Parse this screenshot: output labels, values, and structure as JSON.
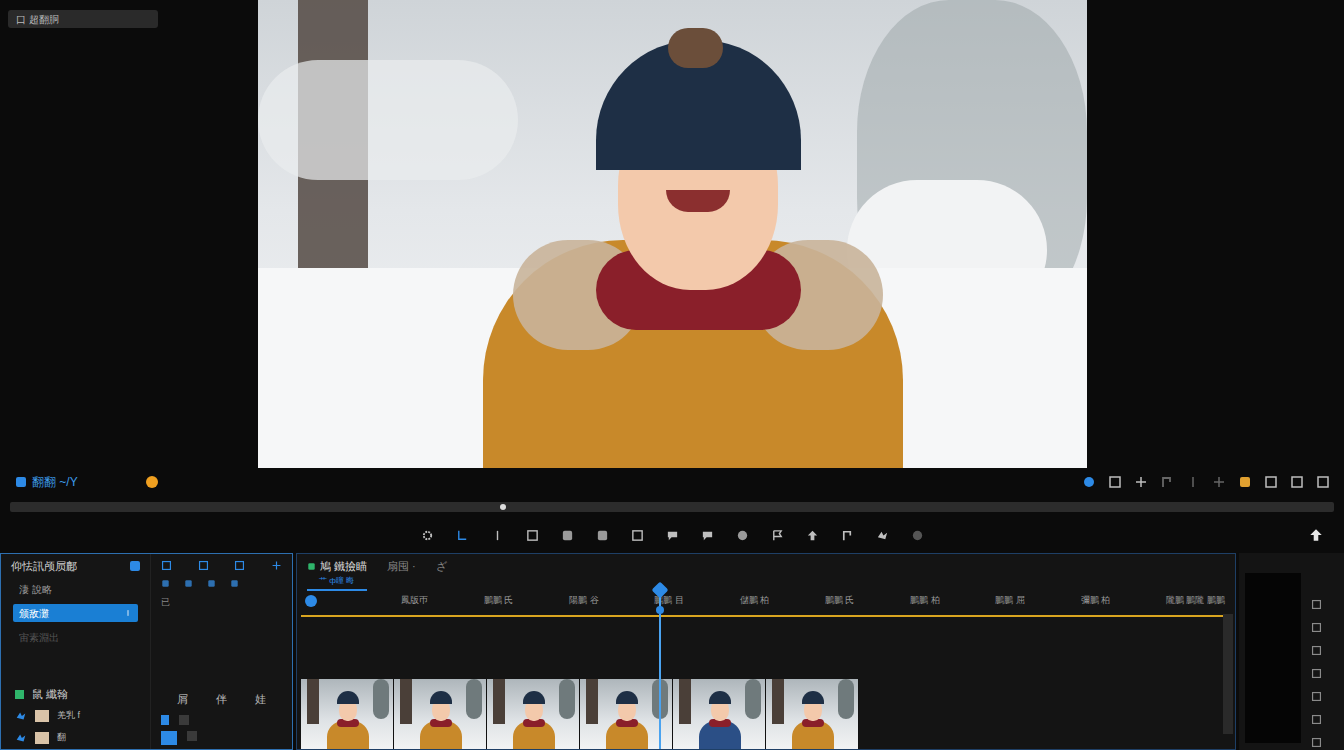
{
  "app": {
    "badge": "口 超翻胴"
  },
  "preview_toolbar": {
    "label": "翻翻 ~/Y"
  },
  "left_panel": {
    "title": "仰怯訊颅屃鄜",
    "items": [
      {
        "label": "淒 說略",
        "selected": false,
        "disabled": false
      },
      {
        "label": "颁敌灘",
        "selected": true,
        "disabled": false
      },
      {
        "label": "宙素淵出",
        "selected": false,
        "disabled": true
      }
    ],
    "tracks_title": "鼠 纖翰",
    "track_rows": [
      {
        "label": "羌乳 f"
      },
      {
        "label": "翻"
      }
    ],
    "column_headers": [
      "屑",
      "伴",
      "娃"
    ],
    "side_mark": "已"
  },
  "timeline": {
    "tabs": [
      {
        "label": "鳩 鐵撿瞄",
        "selected": true
      },
      {
        "label": "扇囤 ·",
        "selected": false
      },
      {
        "label": "ざ",
        "selected": false
      }
    ],
    "subtitle": "艹 ф瞳 晦",
    "ruler_labels": [
      "鳳版帀",
      "鵬鵬 氏",
      "陽鵬 谷",
      "鵬鵬 目",
      "儲鵬 柏",
      "鵬鵬 氏",
      "鵬鵬 柏",
      "鵬鵬 屈",
      "彌鵬 柏",
      "隴鵬 鵬隴 鵬鵬"
    ],
    "playhead": {
      "level": 0.39
    },
    "clips": [
      {
        "color": "#c8892a"
      },
      {
        "color": "#c8892a"
      },
      {
        "color": "#c8892a"
      },
      {
        "color": "#c8892a"
      },
      {
        "color": "#2b4f86"
      },
      {
        "color": "#c8892a"
      }
    ]
  }
}
